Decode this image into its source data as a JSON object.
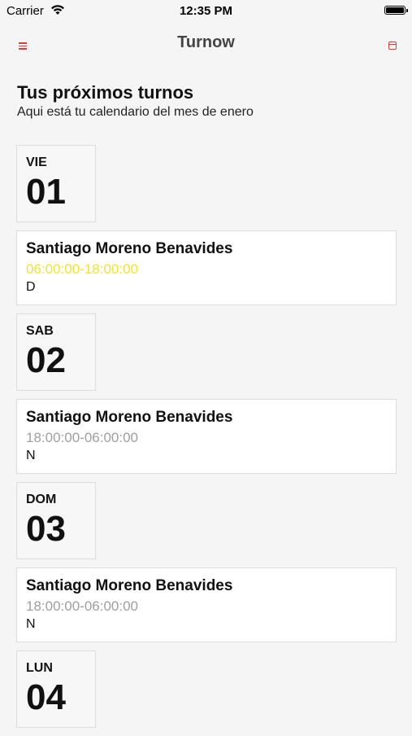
{
  "status_bar": {
    "carrier": "Carrier",
    "time": "12:35 PM"
  },
  "navbar": {
    "title": "Turnow",
    "menu_icon": "menu-icon",
    "calendar_icon": "calendar-icon"
  },
  "header": {
    "title": "Tus próximos turnos",
    "subtitle": "Aqui está tu calendario del mes de enero"
  },
  "days": [
    {
      "dow": "VIE",
      "num": "01",
      "shift": {
        "name": "Santiago Moreno Benavides",
        "hours": "06:00:00-18:00:00",
        "hours_color": "#f5e32a",
        "code": "D"
      }
    },
    {
      "dow": "SAB",
      "num": "02",
      "shift": {
        "name": "Santiago Moreno Benavides",
        "hours": "18:00:00-06:00:00",
        "hours_color": "#9e9e9e",
        "code": "N"
      }
    },
    {
      "dow": "DOM",
      "num": "03",
      "shift": {
        "name": "Santiago Moreno Benavides",
        "hours": "18:00:00-06:00:00",
        "hours_color": "#9e9e9e",
        "code": "N"
      }
    },
    {
      "dow": "LUN",
      "num": "04"
    }
  ],
  "colors": {
    "accent": "#e53935",
    "background": "#f5f5f5"
  }
}
